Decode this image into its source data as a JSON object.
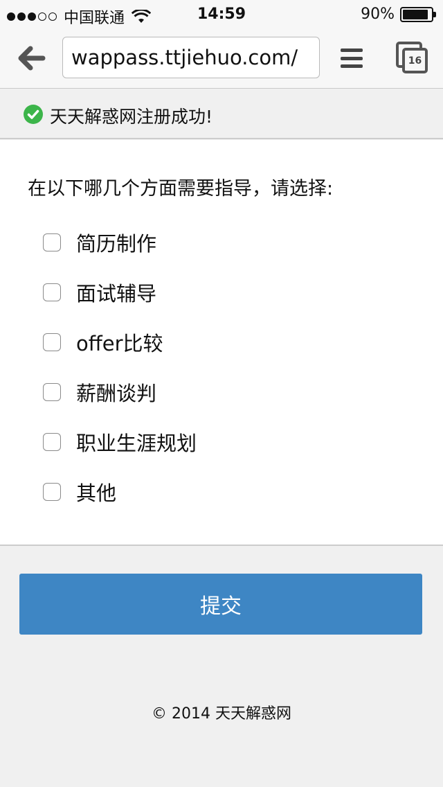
{
  "status_bar": {
    "carrier": "中国联通",
    "time": "14:59",
    "battery": "90%",
    "battery_level": 0.9,
    "signal_bars_filled": 3,
    "signal_bars_total": 5
  },
  "browser": {
    "url": "wappass.ttjiehuo.com/",
    "tab_count": "16"
  },
  "notice": {
    "text": "天天解惑网注册成功!",
    "icon_color": "#3cb54a"
  },
  "form": {
    "question": "在以下哪几个方面需要指导，请选择:",
    "options": [
      {
        "label": "简历制作",
        "checked": false
      },
      {
        "label": "面试辅导",
        "checked": false
      },
      {
        "label": "offer比较",
        "checked": false
      },
      {
        "label": "薪酬谈判",
        "checked": false
      },
      {
        "label": "职业生涯规划",
        "checked": false
      },
      {
        "label": "其他",
        "checked": false
      }
    ],
    "submit_label": "提交",
    "submit_color": "#3e86c4"
  },
  "footer": {
    "text": "© 2014 天天解惑网"
  }
}
